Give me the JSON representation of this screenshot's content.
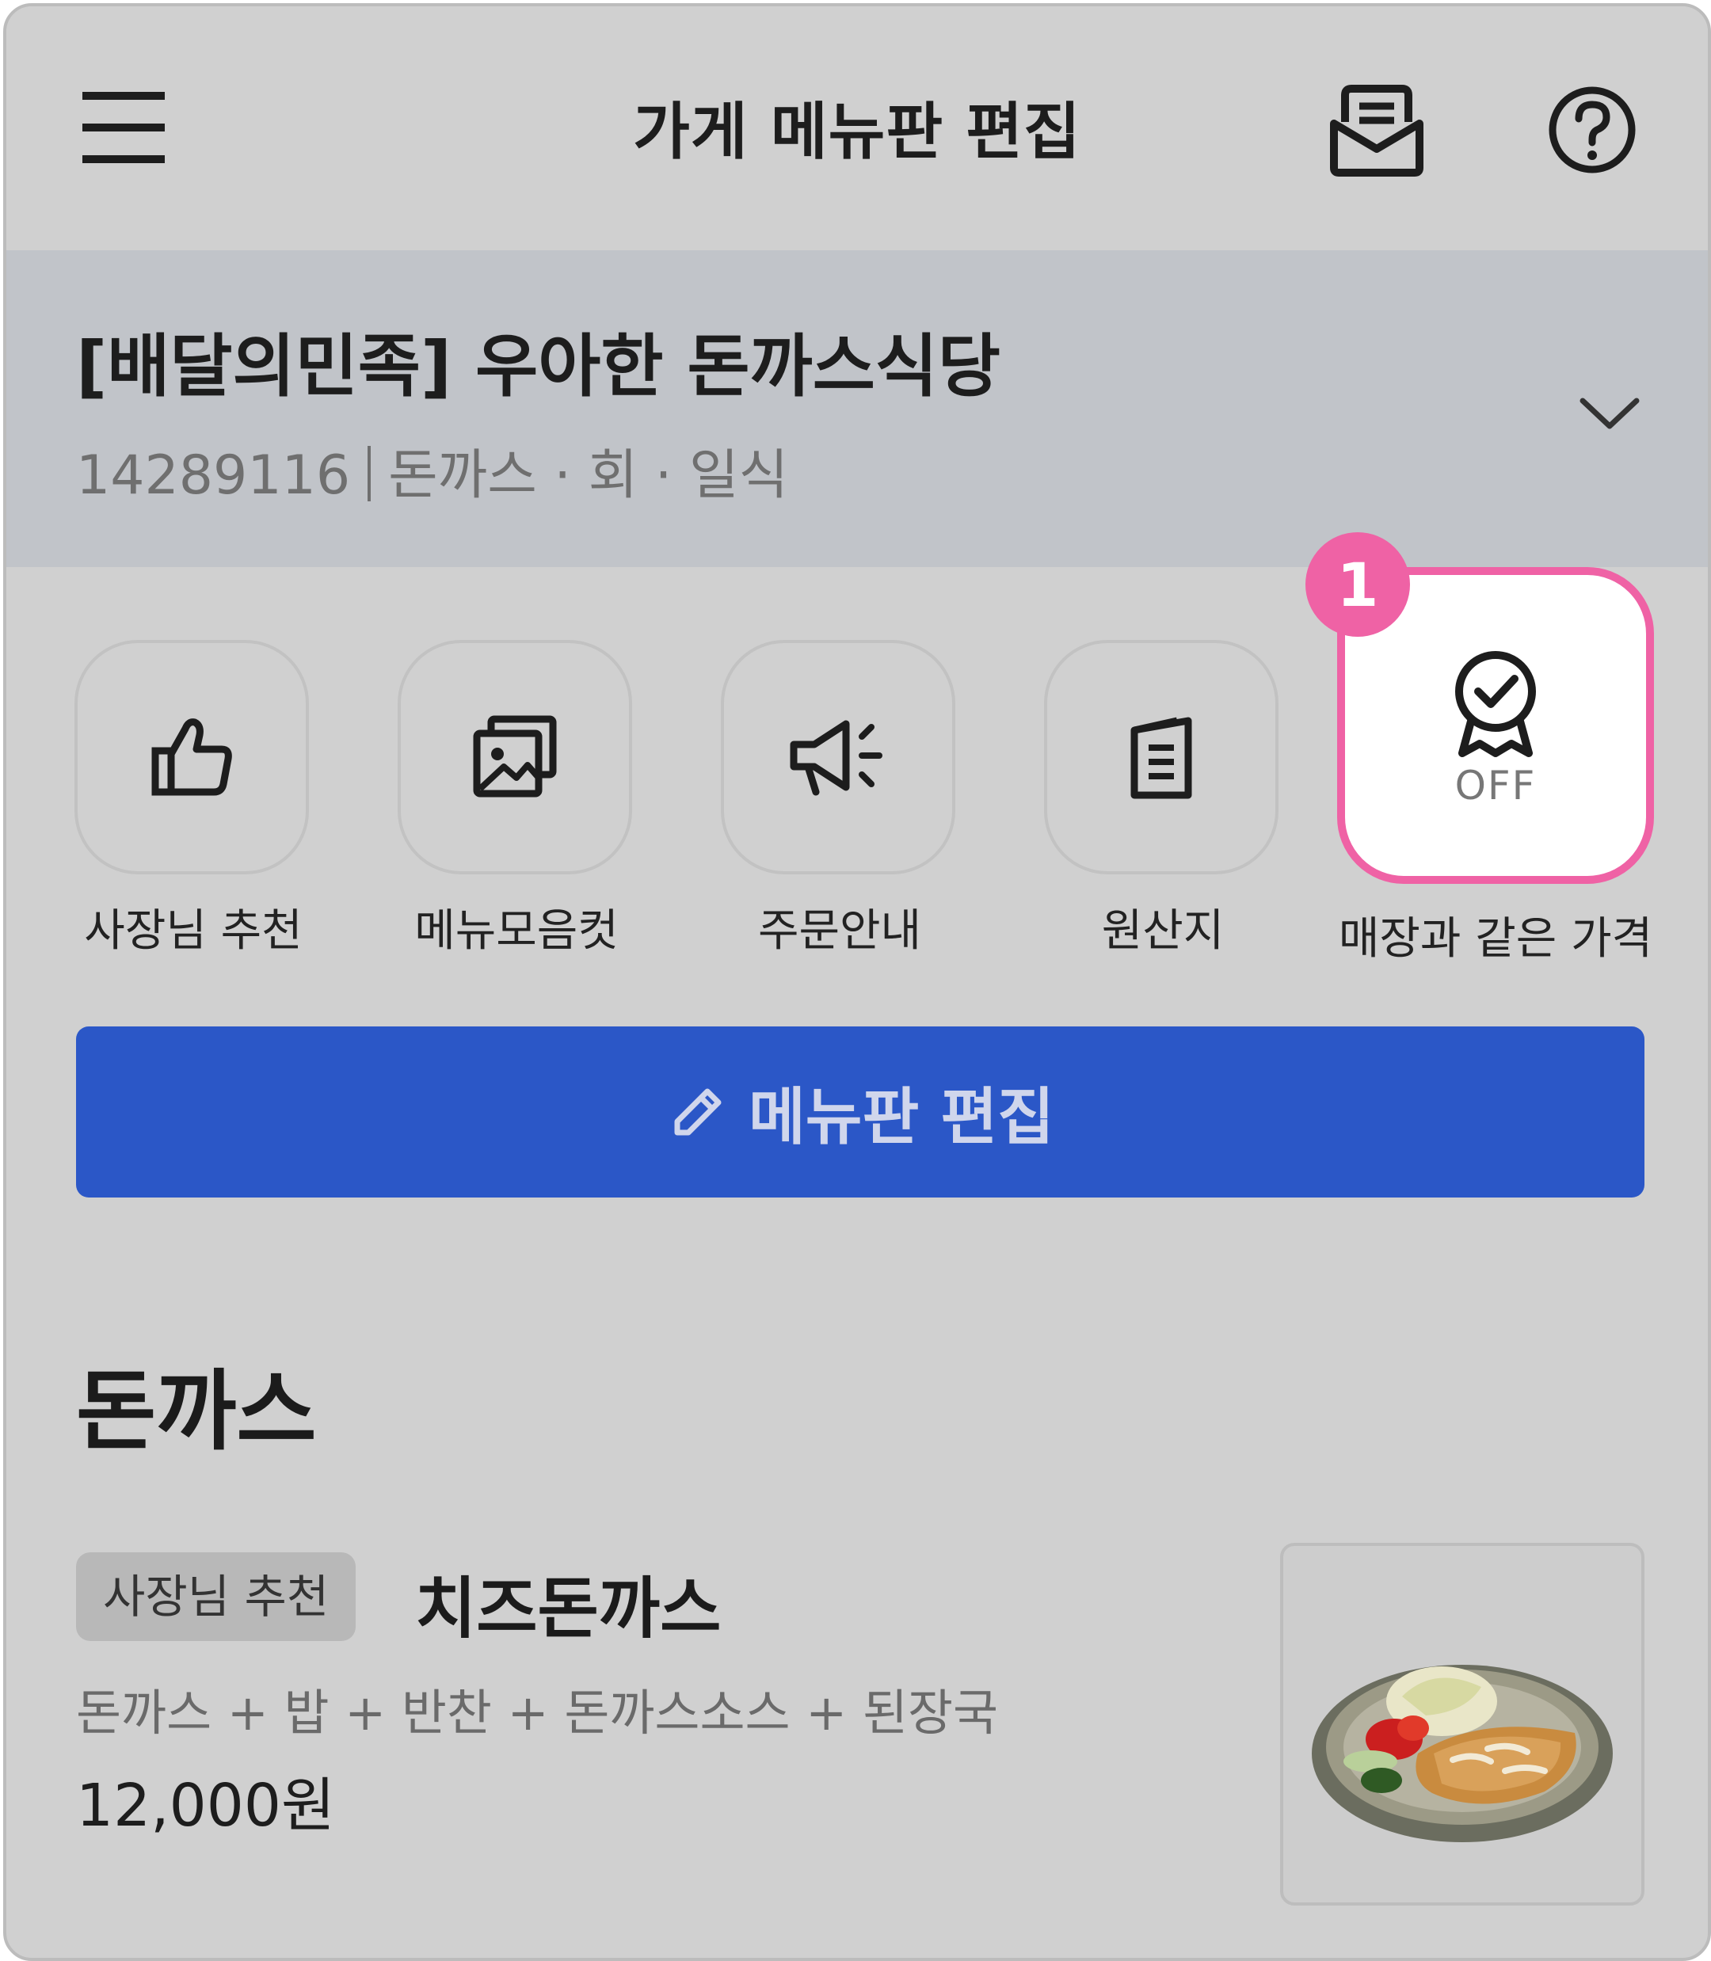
{
  "appbar": {
    "title": "가게 메뉴판 편집",
    "menu_icon": "hamburger-menu-icon",
    "inbox_icon": "inbox-icon",
    "help_icon": "help-circle-icon"
  },
  "store": {
    "name": "[배달의민족] 우아한 돈까스식당",
    "id": "14289116",
    "categories": "돈까스 · 회 · 일식",
    "expand_icon": "chevron-down-icon"
  },
  "features": [
    {
      "label": "사장님 추천",
      "icon": "thumbs-up-icon"
    },
    {
      "label": "메뉴모음컷",
      "icon": "image-gallery-icon"
    },
    {
      "label": "주문안내",
      "icon": "megaphone-icon"
    },
    {
      "label": "원산지",
      "icon": "document-icon"
    },
    {
      "label": "매장과 같은 가격",
      "icon": "badge-check-icon",
      "status": "OFF"
    }
  ],
  "step_badge": "1",
  "edit_button": {
    "label": "메뉴판 편집",
    "icon": "pencil-icon"
  },
  "section": {
    "title": "돈까스"
  },
  "menu_item": {
    "tag": "사장님 추천",
    "name": "치즈돈까스",
    "description": "돈까스 + 밥 + 반찬 + 돈까스소스 + 된장국",
    "price": "12,000원"
  },
  "colors": {
    "accent": "#2b57c7",
    "highlight": "#ef62a5",
    "background": "#d0d0d0",
    "store_header": "#c1c4c9"
  }
}
